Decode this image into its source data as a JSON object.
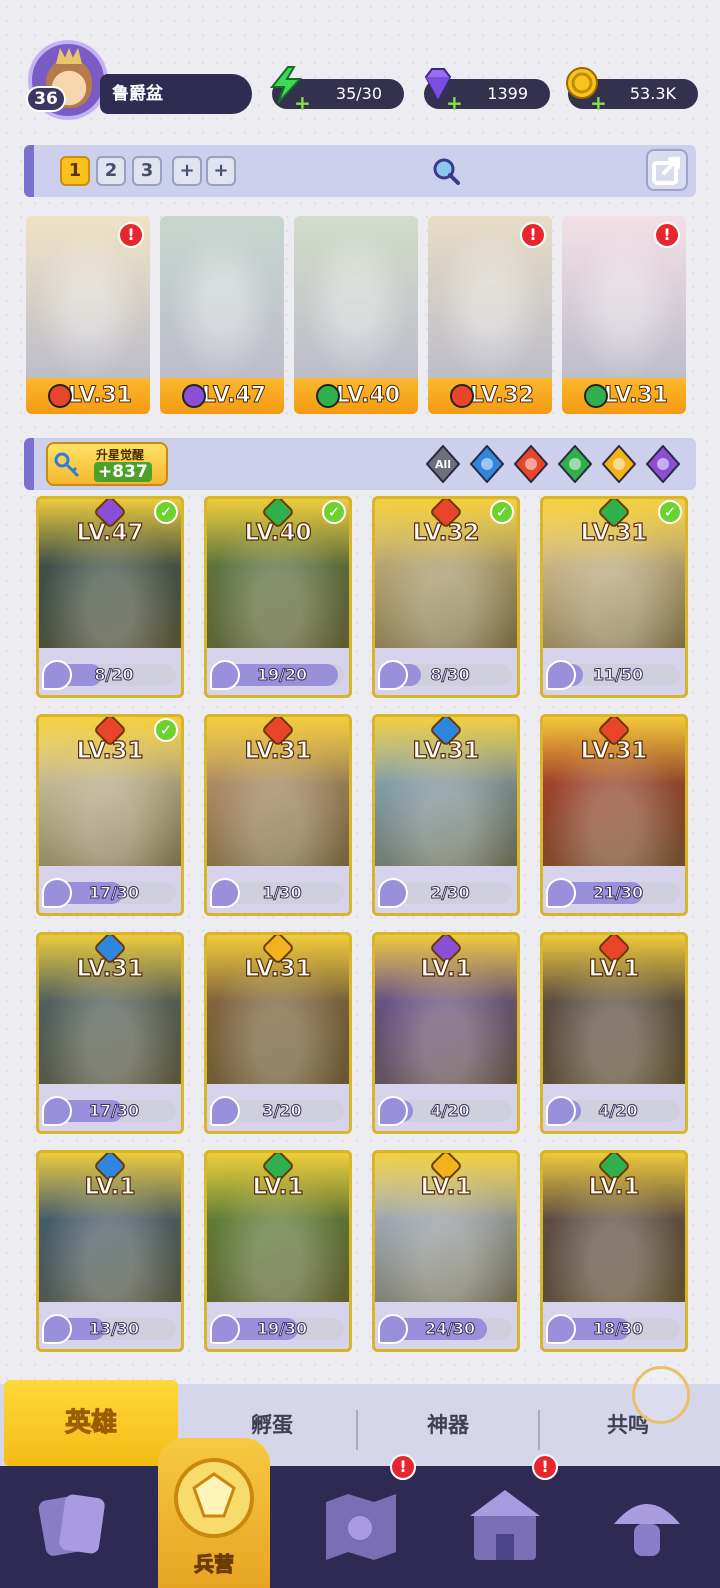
{
  "player": {
    "level": "36",
    "name": "鲁爵盆"
  },
  "resources": [
    {
      "name": "energy",
      "icon": "lightning-icon",
      "value": "35/30"
    },
    {
      "name": "gems",
      "icon": "diamond-icon",
      "value": "1399"
    },
    {
      "name": "coins",
      "icon": "coin-icon",
      "value": "53.3K"
    }
  ],
  "team_tabs": [
    "1",
    "2",
    "3",
    "+",
    "+"
  ],
  "team": [
    {
      "element": "fire",
      "element_color": "#e8452b",
      "level": "LV.31",
      "alert": "!",
      "tint": "#efe3c6"
    },
    {
      "element": "dark",
      "element_color": "#8b4fd6",
      "level": "LV.47",
      "alert": "",
      "tint": "#c9d6cf"
    },
    {
      "element": "nature",
      "element_color": "#30b04c",
      "level": "LV.40",
      "alert": "",
      "tint": "#d3dccb"
    },
    {
      "element": "fire",
      "element_color": "#e8452b",
      "level": "LV.32",
      "alert": "!",
      "tint": "#e6ddc6"
    },
    {
      "element": "nature",
      "element_color": "#30b04c",
      "level": "LV.31",
      "alert": "!",
      "tint": "#f3e0e6"
    }
  ],
  "awaken": {
    "label": "升星觉醒",
    "value": "+837"
  },
  "filters": [
    {
      "name": "all",
      "label": "All",
      "color": "#6e6e80"
    },
    {
      "name": "water",
      "label": "",
      "color": "#2f86e0"
    },
    {
      "name": "fire",
      "label": "",
      "color": "#e8452b"
    },
    {
      "name": "nature",
      "label": "",
      "color": "#30b04c"
    },
    {
      "name": "light",
      "label": "",
      "color": "#f2b21c"
    },
    {
      "name": "dark",
      "label": "",
      "color": "#8b4fd6"
    }
  ],
  "heroes": [
    {
      "level": "LV.47",
      "element_color": "#8b4fd6",
      "progress": "8/20",
      "ratio": 0.4,
      "checked": true,
      "tint": "#2f4d55"
    },
    {
      "level": "LV.40",
      "element_color": "#30b04c",
      "progress": "19/20",
      "ratio": 0.95,
      "checked": true,
      "tint": "#5b7f45"
    },
    {
      "level": "LV.32",
      "element_color": "#e8452b",
      "progress": "8/30",
      "ratio": 0.27,
      "checked": true,
      "tint": "#d8c48f"
    },
    {
      "level": "LV.31",
      "element_color": "#30b04c",
      "progress": "11/50",
      "ratio": 0.22,
      "checked": true,
      "tint": "#f2d9a8"
    },
    {
      "level": "LV.31",
      "element_color": "#e8452b",
      "progress": "17/30",
      "ratio": 0.57,
      "checked": true,
      "tint": "#e9dcbc"
    },
    {
      "level": "LV.31",
      "element_color": "#e8452b",
      "progress": "1/30",
      "ratio": 0.03,
      "checked": false,
      "tint": "#c9a07a"
    },
    {
      "level": "LV.31",
      "element_color": "#2f86e0",
      "progress": "2/30",
      "ratio": 0.07,
      "checked": false,
      "tint": "#8fb9da"
    },
    {
      "level": "LV.31",
      "element_color": "#e8452b",
      "progress": "21/30",
      "ratio": 0.7,
      "checked": false,
      "tint": "#b73a2a"
    },
    {
      "level": "LV.31",
      "element_color": "#2f86e0",
      "progress": "17/30",
      "ratio": 0.57,
      "checked": false,
      "tint": "#4a6270"
    },
    {
      "level": "LV.31",
      "element_color": "#f2b21c",
      "progress": "3/20",
      "ratio": 0.15,
      "checked": false,
      "tint": "#8c6a45"
    },
    {
      "level": "LV.1",
      "element_color": "#8b4fd6",
      "progress": "4/20",
      "ratio": 0.2,
      "checked": false,
      "tint": "#6b4fa8"
    },
    {
      "level": "LV.1",
      "element_color": "#e8452b",
      "progress": "4/20",
      "ratio": 0.2,
      "checked": false,
      "tint": "#5a4a4a"
    },
    {
      "level": "LV.1",
      "element_color": "#2f86e0",
      "progress": "13/30",
      "ratio": 0.43,
      "checked": false,
      "tint": "#3a5e86"
    },
    {
      "level": "LV.1",
      "element_color": "#30b04c",
      "progress": "19/30",
      "ratio": 0.63,
      "checked": false,
      "tint": "#5e8c3a"
    },
    {
      "level": "LV.1",
      "element_color": "#f2b21c",
      "progress": "24/30",
      "ratio": 0.8,
      "checked": false,
      "tint": "#b7c8e6"
    },
    {
      "level": "LV.1",
      "element_color": "#30b04c",
      "progress": "18/30",
      "ratio": 0.6,
      "checked": false,
      "tint": "#5d4a4e"
    }
  ],
  "subtabs": {
    "heroes": "英雄",
    "hatch": "孵蛋",
    "artifact": "神器",
    "resonance": "共鸣"
  },
  "nav": {
    "barracks": "兵营",
    "alert": "!"
  }
}
